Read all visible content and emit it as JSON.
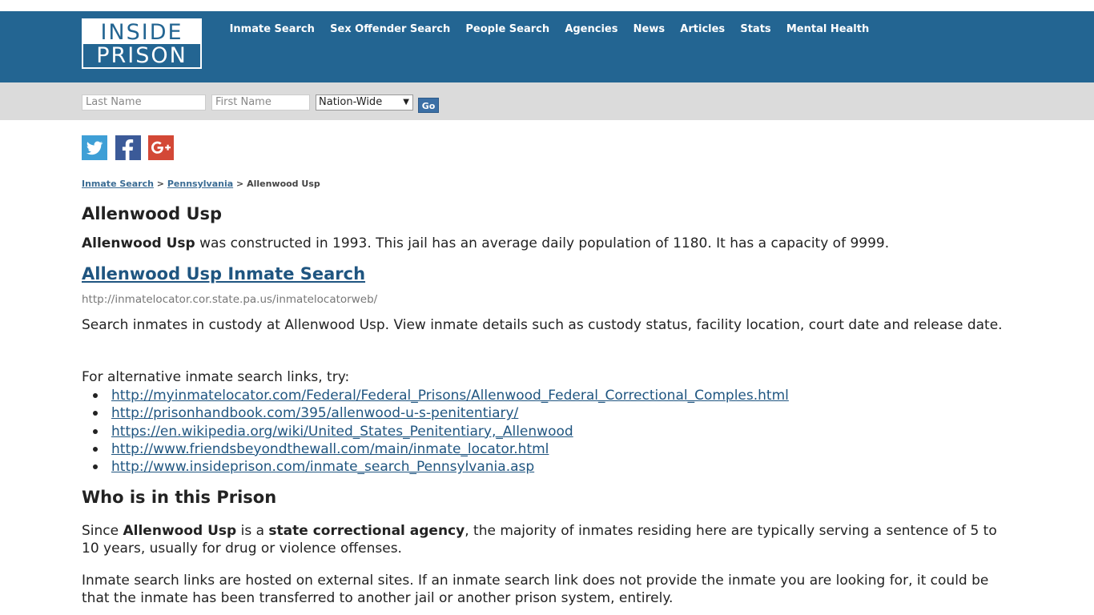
{
  "logo": {
    "line1": "INSIDE",
    "line2": "PRISON"
  },
  "nav": [
    "Inmate Search",
    "Sex Offender Search",
    "People Search",
    "Agencies",
    "News",
    "Articles",
    "Stats",
    "Mental Health"
  ],
  "search": {
    "last_placeholder": "Last Name",
    "first_placeholder": "First Name",
    "scope": "Nation-Wide",
    "go_label": "Go"
  },
  "social": [
    "twitter-icon",
    "facebook-icon",
    "google-plus-icon"
  ],
  "breadcrumb": {
    "root": "Inmate Search",
    "sep1": ">",
    "state": "Pennsylvania",
    "sep2": ">",
    "current": "Allenwood Usp"
  },
  "page_title": "Allenwood Usp",
  "intro": {
    "name": "Allenwood Usp",
    "rest": " was constructed in 1993. This jail has an average daily population of 1180. It has a capacity of 9999."
  },
  "search_link": {
    "label": "Allenwood Usp Inmate Search",
    "url": "http://inmatelocator.cor.state.pa.us/inmatelocatorweb/"
  },
  "description": "Search inmates in custody at Allenwood Usp. View inmate details such as custody status, facility location, court date and release date.",
  "alt_intro": "For alternative inmate search links, try:",
  "alt_links": [
    "http://myinmatelocator.com/Federal/Federal_Prisons/Allenwood_Federal_Correctional_Comples.html",
    "http://prisonhandbook.com/395/allenwood-u-s-penitentiary/",
    "https://en.wikipedia.org/wiki/United_States_Penitentiary,_Allenwood",
    "http://www.friendsbeyondthewall.com/main/inmate_locator.html",
    "http://www.insideprison.com/inmate_search_Pennsylvania.asp"
  ],
  "who_title": "Who is in this Prison",
  "who_p1": {
    "t1": "Since ",
    "b1": "Allenwood Usp",
    "t2": " is a ",
    "b2": "state correctional agency",
    "t3": ", the majority of inmates residing here are typically serving a sentence of 5 to 10 years, usually for drug or violence offenses."
  },
  "who_p2": "Inmate search links are hosted on external sites. If an inmate search link does not provide the inmate you are looking for, it could be that the inmate has been transferred to another jail or another prison system, entirely.",
  "colors": {
    "header": "#236592",
    "searchbar": "#dbdbdb",
    "link": "#1f5580",
    "go": "#3b6fa5",
    "twitter": "#3e9fd6",
    "facebook": "#3b5a98",
    "google": "#d34836"
  }
}
